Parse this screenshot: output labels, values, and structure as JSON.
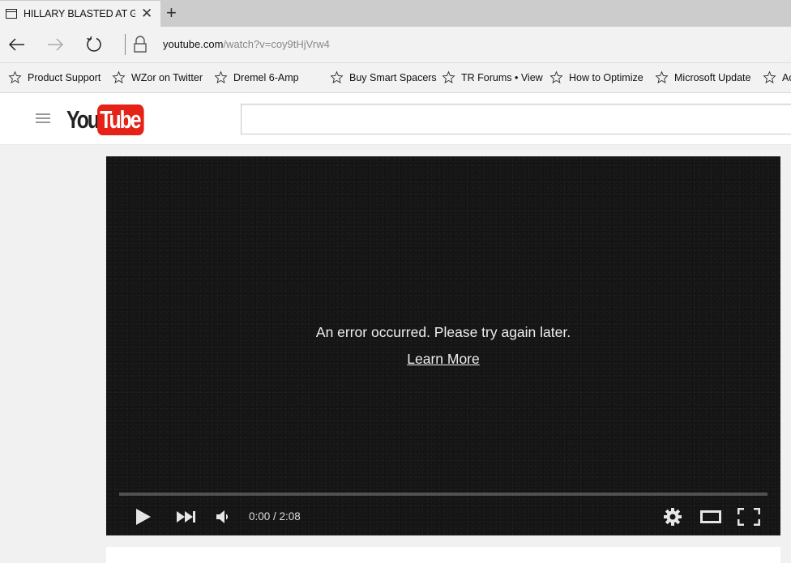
{
  "browser": {
    "tab": {
      "title": "HILLARY BLASTED AT GI",
      "icon": "page-icon",
      "close_icon": "✕"
    },
    "new_tab_icon": "+",
    "nav": {
      "back_icon": "arrow-left-icon",
      "forward_icon": "arrow-right-icon",
      "refresh_icon": "refresh-icon",
      "lock_icon": "lock-icon"
    },
    "url": {
      "domain": "youtube.com",
      "path": "/watch?v=coy9tHjVrw4"
    },
    "favorites": [
      {
        "label": "Product Support"
      },
      {
        "label": "WZor on Twitter"
      },
      {
        "label": "Dremel 6-Amp"
      },
      {
        "label": "Buy Smart Spacers"
      },
      {
        "label": "TR Forums • View"
      },
      {
        "label": "How to Optimize"
      },
      {
        "label": "Microsoft Update"
      },
      {
        "label": "Ac"
      }
    ]
  },
  "youtube": {
    "logo": {
      "you": "You",
      "tube": "Tube"
    },
    "search": {
      "value": "",
      "placeholder": ""
    },
    "brand_color": "#e62117"
  },
  "player": {
    "error_message": "An error occurred. Please try again later.",
    "learn_more": "Learn More",
    "time": "0:00 / 2:08",
    "progress": 0,
    "controls": [
      "play",
      "next",
      "volume",
      "settings",
      "theater-mode",
      "fullscreen"
    ]
  }
}
